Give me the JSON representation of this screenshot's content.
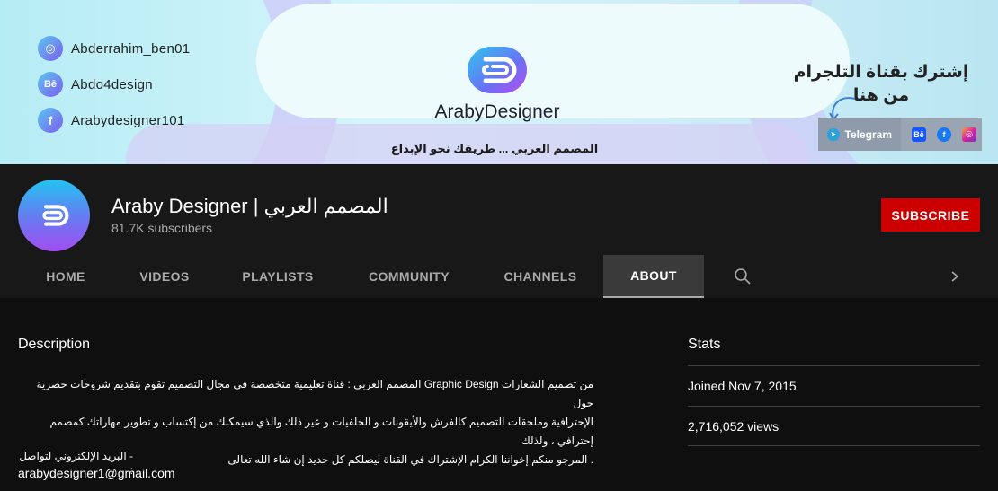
{
  "banner": {
    "social": [
      {
        "icon": "instagram-icon",
        "glyph": "◎",
        "handle": "Abderrahim_ben01"
      },
      {
        "icon": "behance-icon",
        "glyph": "Bē",
        "handle": "Abdo4design"
      },
      {
        "icon": "facebook-icon",
        "glyph": "f",
        "handle": "Arabydesigner101"
      }
    ],
    "brand_part1": "Araby",
    "brand_part2": "Designer",
    "tagline": "المصمم العربي ... طريقك نحو الإبداع",
    "telegram_line1": "إشترك بقناة التلجرام",
    "telegram_line2": "من هنا",
    "telegram_label": "Telegram"
  },
  "channel": {
    "title": "Araby Designer | المصمم العربي",
    "subscribers": "81.7K subscribers",
    "subscribe_label": "SUBSCRIBE"
  },
  "tabs": [
    {
      "label": "HOME",
      "active": false
    },
    {
      "label": "VIDEOS",
      "active": false
    },
    {
      "label": "PLAYLISTS",
      "active": false
    },
    {
      "label": "COMMUNITY",
      "active": false
    },
    {
      "label": "CHANNELS",
      "active": false
    },
    {
      "label": "ABOUT",
      "active": true
    }
  ],
  "about": {
    "description_heading": "Description",
    "description_lines": [
      "من تصميم الشعارات  Graphic Design المصمم العربي : قناة تعليمية متخصصة في مجال التصميم  تقوم بتقديم شروحات حصرية  حول",
      "الإحترافية وملحقات التصميم كالفرش والأيقونات و الخلفيات  و عير ذلك  والذي  سيمكنك من إكتساب و تطوير مهاراتك كمصمم إحترافي ، ولذلك",
      ". المرجو منكم إخواننا الكرام الإشتراك في القناة ليصلكم كل جديد إن شاء الله تعالى"
    ],
    "contact_line": "- البريد الإلكتروني لتواصل :",
    "email": "arabydesigner1@gmail.com",
    "stats_heading": "Stats",
    "joined": "Joined Nov 7, 2015",
    "views": "2,716,052 views"
  },
  "colors": {
    "subscribe": "#cc0000",
    "page_bg": "#0f0f0f",
    "header_bg": "#181818"
  }
}
